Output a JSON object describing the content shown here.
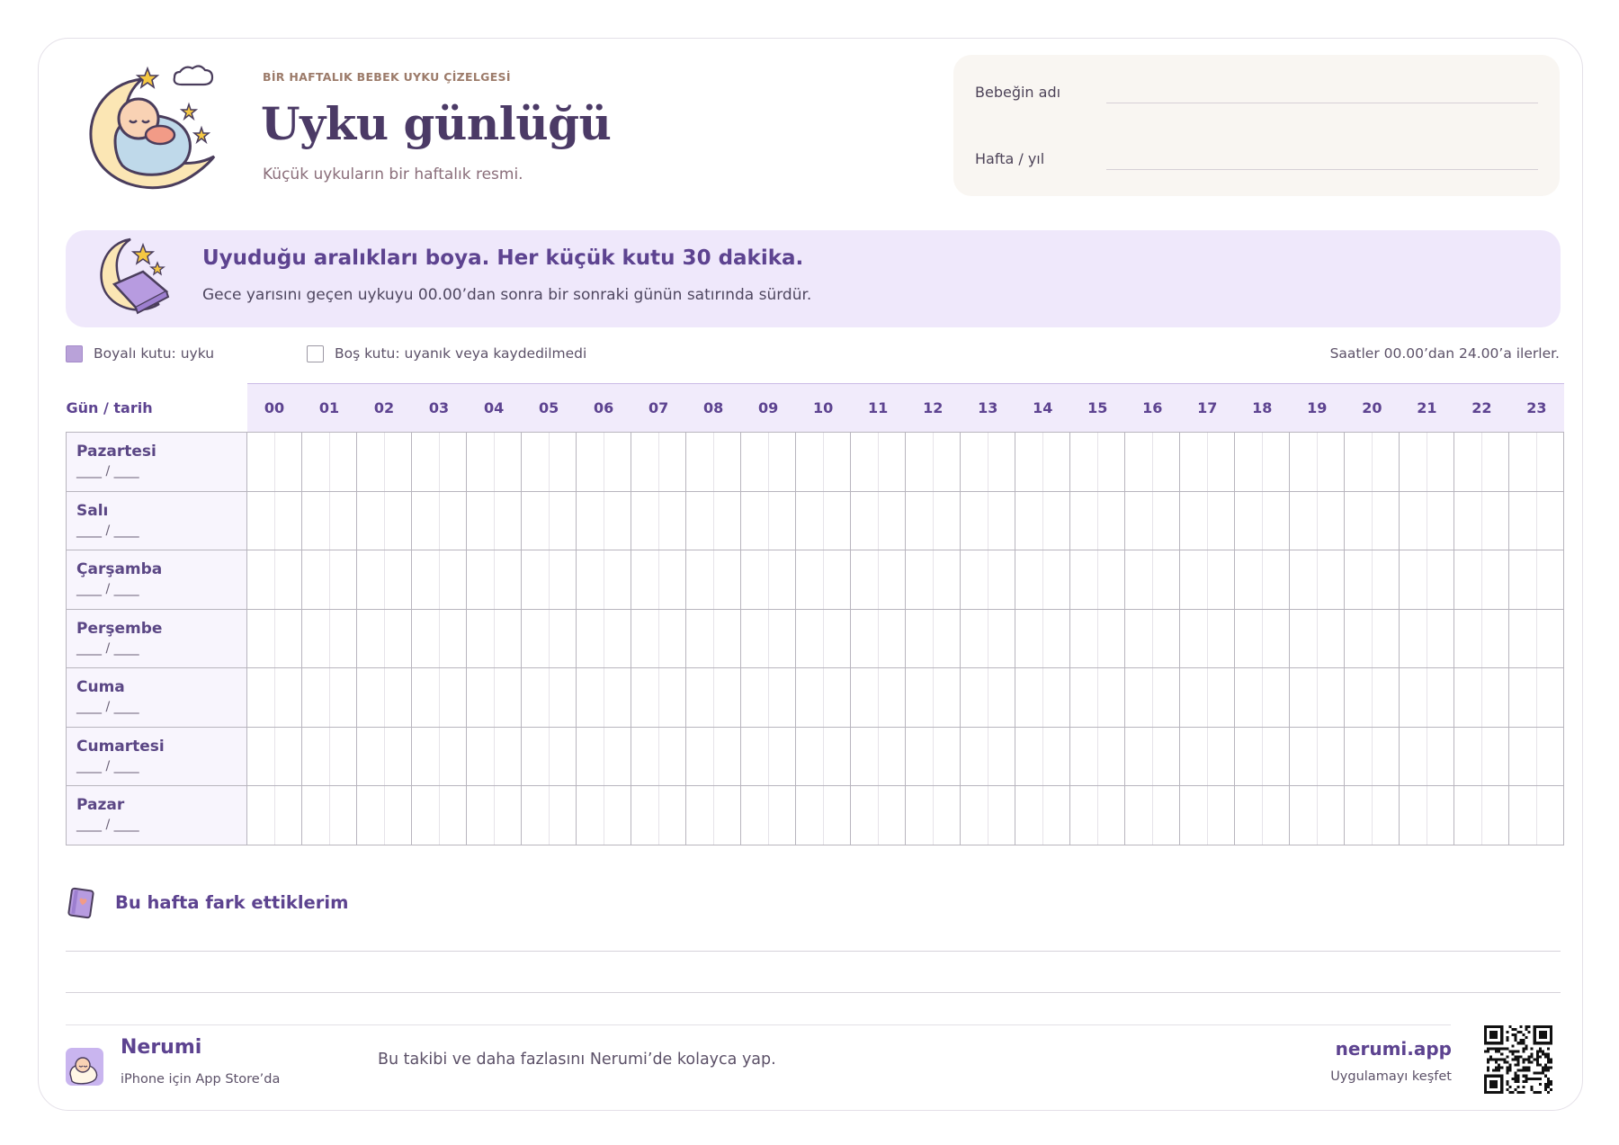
{
  "header": {
    "eyebrow": "BİR HAFTALIK BEBEK UYKU ÇİZELGESİ",
    "title": "Uyku günlüğü",
    "subtitle": "Küçük uykuların bir haftalık resmi."
  },
  "fields": {
    "baby_name_label": "Bebeğin adı",
    "week_year_label": "Hafta / yıl"
  },
  "banner": {
    "title": "Uyuduğu aralıkları boya. Her küçük kutu 30 dakika.",
    "subtitle": "Gece yarısını geçen uykuyu 00.00’dan sonra bir sonraki günün satırında sürdür."
  },
  "legend": {
    "filled": "Boyalı kutu: uyku",
    "empty": "Boş kutu: uyanık veya kaydedilmedi",
    "hours_note": "Saatler 00.00’dan 24.00’a ilerler."
  },
  "grid": {
    "day_header": "Gün / tarih",
    "hours": [
      "00",
      "01",
      "02",
      "03",
      "04",
      "05",
      "06",
      "07",
      "08",
      "09",
      "10",
      "11",
      "12",
      "13",
      "14",
      "15",
      "16",
      "17",
      "18",
      "19",
      "20",
      "21",
      "22",
      "23"
    ],
    "date_placeholder": "____ / ____",
    "days": [
      "Pazartesi",
      "Salı",
      "Çarşamba",
      "Perşembe",
      "Cuma",
      "Cumartesi",
      "Pazar"
    ]
  },
  "notes": {
    "title": "Bu hafta fark ettiklerim"
  },
  "footer": {
    "brand": "Nerumi",
    "brand_sub": "iPhone için App Store’da",
    "promo": "Bu takibi ve daha fazlasını Nerumi’de kolayca yap.",
    "site": "nerumi.app",
    "site_sub": "Uygulamayı keşfet"
  },
  "colors": {
    "accent": "#5d4390",
    "sleep_fill": "#b9a2d9",
    "banner_bg": "#efe8fb",
    "fields_bg": "#f9f6f2"
  },
  "icons": {
    "logo": "baby-moon-icon",
    "banner": "moon-blanket-icon",
    "notes": "notebook-icon",
    "app": "app-icon",
    "qr": "qr-code-icon"
  }
}
